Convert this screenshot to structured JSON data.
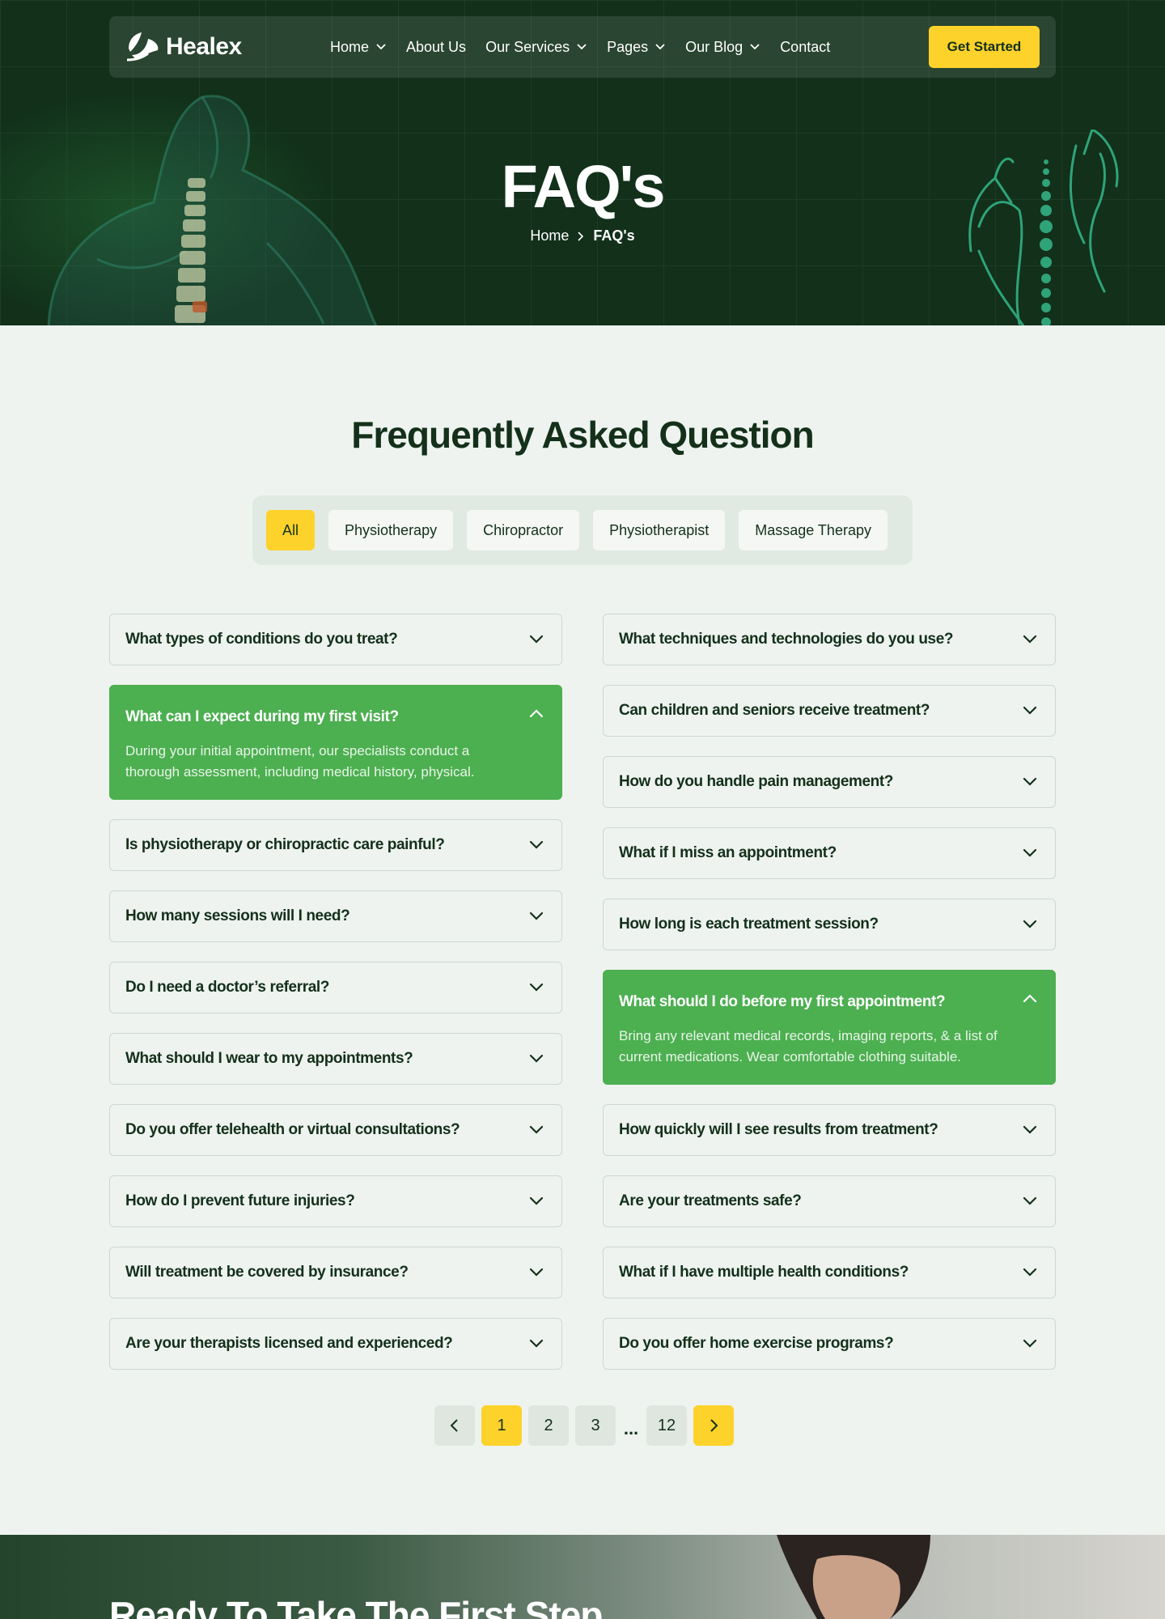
{
  "brand": {
    "name": "Healex"
  },
  "nav": {
    "items": [
      {
        "label": "Home",
        "dropdown": true
      },
      {
        "label": "About Us",
        "dropdown": false
      },
      {
        "label": "Our Services",
        "dropdown": true
      },
      {
        "label": "Pages",
        "dropdown": true
      },
      {
        "label": "Our Blog",
        "dropdown": true
      },
      {
        "label": "Contact",
        "dropdown": false
      }
    ],
    "cta_label": "Get Started"
  },
  "hero": {
    "title": "FAQ's",
    "breadcrumb": {
      "home": "Home",
      "current": "FAQ's"
    }
  },
  "faq_section": {
    "title": "Frequently Asked Question",
    "filters": [
      "All",
      "Physiotherapy",
      "Chiropractor",
      "Physiotherapist",
      "Massage Therapy"
    ],
    "active_filter": "All",
    "left": [
      {
        "q": "What types of conditions do you treat?"
      },
      {
        "q": "What can I expect during my first visit?",
        "open": true,
        "a": "During your initial appointment, our specialists conduct a thorough assessment, including medical history, physical."
      },
      {
        "q": "Is physiotherapy or chiropractic care painful?"
      },
      {
        "q": "How many sessions will I need?"
      },
      {
        "q": "Do I need a doctor’s referral?"
      },
      {
        "q": "What should I wear to my appointments?"
      },
      {
        "q": "Do you offer telehealth or virtual consultations?"
      },
      {
        "q": "How do I prevent future injuries?"
      },
      {
        "q": "Will treatment be covered by insurance?"
      },
      {
        "q": "Are your therapists licensed and experienced?"
      }
    ],
    "right": [
      {
        "q": "What techniques and technologies do you use?"
      },
      {
        "q": "Can children and seniors receive treatment?"
      },
      {
        "q": "How do you handle pain management?"
      },
      {
        "q": "What if I miss an appointment?"
      },
      {
        "q": "How long is each treatment session?"
      },
      {
        "q": "What should I do before my first appointment?",
        "open": true,
        "a": "Bring any relevant medical records, imaging reports, & a list of current medications. Wear comfortable clothing suitable."
      },
      {
        "q": "How quickly will I see results from treatment?"
      },
      {
        "q": "Are your treatments safe?"
      },
      {
        "q": "What if I have multiple health conditions?"
      },
      {
        "q": "Do you offer home exercise programs?"
      }
    ]
  },
  "pagination": {
    "pages": [
      "1",
      "2",
      "3"
    ],
    "ellipsis": "...",
    "last": "12",
    "current": "1"
  },
  "cta": {
    "title": "Ready To Take The First Step"
  },
  "colors": {
    "dark_green": "#12301a",
    "accent_yellow": "#fdd22b",
    "open_green": "#4caf50",
    "page_bg": "#eef3ef"
  }
}
